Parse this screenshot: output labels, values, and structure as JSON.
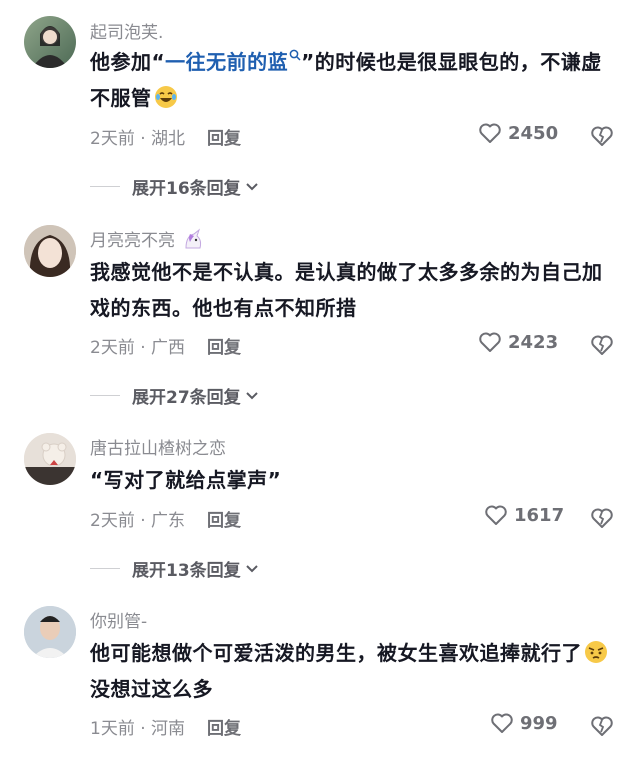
{
  "comments": [
    {
      "username": "起司泡芙.",
      "text_parts": [
        "他参加“",
        "一往无前的蓝",
        "”的时候也是很显眼包的，不谦虚不服管"
      ],
      "meta": "2天前 · 湖北",
      "reply_label": "回复",
      "likes": "2450",
      "expand_label": "展开16条回复"
    },
    {
      "username": "月亮亮不亮",
      "text": "我感觉他不是不认真。是认真的做了太多多余的为自己加戏的东西。他也有点不知所措",
      "meta": "2天前 · 广西",
      "reply_label": "回复",
      "likes": "2423",
      "expand_label": "展开27条回复"
    },
    {
      "username": "唐古拉山楂树之恋",
      "text": "“写对了就给点掌声”",
      "meta": "2天前 · 广东",
      "reply_label": "回复",
      "likes": "1617",
      "expand_label": "展开13条回复"
    },
    {
      "username": "你别管-",
      "text_parts": [
        "他可能想做个可爱活泼的男生，被女生喜欢追捧就行了",
        "没想过这么多"
      ],
      "meta": "1天前 · 河南",
      "reply_label": "回复",
      "likes": "999"
    }
  ],
  "colors": {
    "link": "#1f5fb0",
    "secondary_text": "#8a8b91",
    "primary_text": "#161823"
  },
  "icons": [
    "heart-outline-icon",
    "broken-heart-icon",
    "search-icon",
    "chevron-down-icon",
    "laugh-cry-emoji",
    "unicorn-emoji",
    "pleading-emoji"
  ]
}
